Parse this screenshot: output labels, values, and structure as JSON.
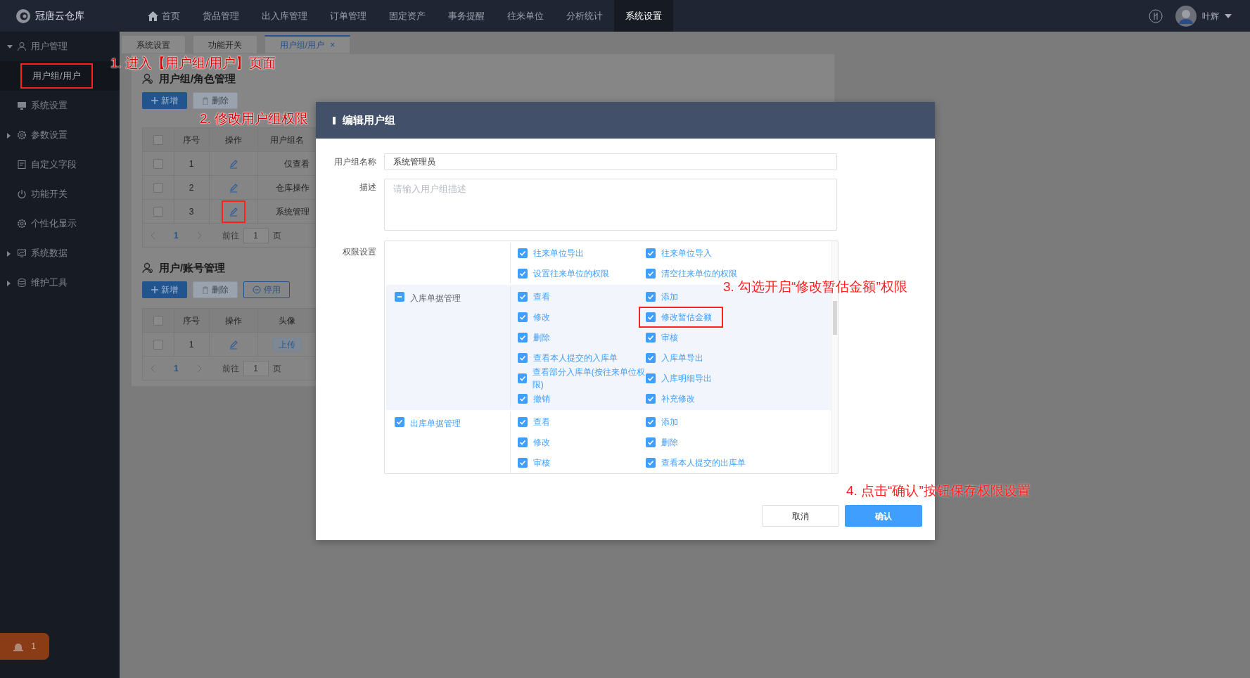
{
  "topbar": {
    "brand": "冠唐云仓库",
    "nav": [
      {
        "label": "首页",
        "selected": false
      },
      {
        "label": "货品管理",
        "selected": false
      },
      {
        "label": "出入库管理",
        "selected": false
      },
      {
        "label": "订单管理",
        "selected": false
      },
      {
        "label": "固定资产",
        "selected": false
      },
      {
        "label": "事务提醒",
        "selected": false
      },
      {
        "label": "往来单位",
        "selected": false
      },
      {
        "label": "分析统计",
        "selected": false
      },
      {
        "label": "系统设置",
        "selected": true
      }
    ],
    "user": {
      "name": "叶辉"
    }
  },
  "sidebar": {
    "items": [
      {
        "label": "用户管理",
        "kind": "group",
        "expanded": true,
        "selected": false,
        "children": [
          {
            "label": "用户组/用户",
            "selected": true,
            "highlighted": true
          }
        ]
      },
      {
        "label": "系统设置",
        "kind": "link",
        "selected": false
      },
      {
        "label": "参数设置",
        "kind": "group",
        "expanded": false,
        "selected": false
      },
      {
        "label": "自定义字段",
        "kind": "link",
        "selected": false
      },
      {
        "label": "功能开关",
        "kind": "link",
        "selected": false
      },
      {
        "label": "个性化显示",
        "kind": "link",
        "selected": false
      },
      {
        "label": "系统数据",
        "kind": "group",
        "expanded": false,
        "selected": false
      },
      {
        "label": "维护工具",
        "kind": "group",
        "expanded": false,
        "selected": false
      }
    ],
    "alert_badge": {
      "count": "1"
    }
  },
  "tabs": [
    {
      "label": "系统设置",
      "selected": false,
      "closable": false
    },
    {
      "label": "功能开关",
      "selected": false,
      "closable": false
    },
    {
      "label": "用户组/用户",
      "selected": true,
      "closable": true,
      "close": "×"
    }
  ],
  "sections": [
    {
      "title": "用户组/角色管理",
      "buttons": [
        {
          "label": "新增",
          "kind": "primary",
          "disabled": false
        },
        {
          "label": "删除",
          "kind": "delete",
          "disabled": true
        }
      ],
      "table": {
        "all_checked": false,
        "columns": [
          "序号",
          "操作",
          "用户组名"
        ],
        "rows": [
          {
            "checked": false,
            "index": "1",
            "name": "仅查看",
            "highlighted": false
          },
          {
            "checked": false,
            "index": "2",
            "name": "仓库操作",
            "highlighted": false
          },
          {
            "checked": false,
            "index": "3",
            "name": "系统管理",
            "highlighted": true
          }
        ]
      },
      "pager": {
        "page": "1",
        "goto_label": "前往",
        "goto_value": "1",
        "unit": "页"
      }
    },
    {
      "title": "用户/账号管理",
      "buttons": [
        {
          "label": "新增",
          "kind": "primary",
          "disabled": false
        },
        {
          "label": "删除",
          "kind": "delete",
          "disabled": true
        },
        {
          "label": "停用",
          "kind": "disable",
          "disabled": false
        }
      ],
      "table": {
        "all_checked": false,
        "columns": [
          "序号",
          "操作",
          "头像"
        ],
        "rows": [
          {
            "checked": false,
            "index": "1",
            "upload": "上传",
            "highlighted": false
          }
        ]
      },
      "pager": {
        "page": "1",
        "goto_label": "前往",
        "goto_value": "1",
        "unit": "页"
      }
    }
  ],
  "modal": {
    "title": "编辑用户组",
    "fields": [
      {
        "label": "用户组名称",
        "value": "系统管理员"
      },
      {
        "label": "描述",
        "placeholder": "请输入用户组描述"
      }
    ],
    "permissions_label": "权限设置",
    "permission_groups": [
      {
        "hovered": false,
        "permissions": [
          {
            "label": "往来单位导出",
            "checked": true,
            "highlighted": false
          },
          {
            "label": "往来单位导入",
            "checked": true,
            "highlighted": false
          },
          {
            "label": "设置往来单位的权限",
            "checked": true,
            "highlighted": false
          },
          {
            "label": "清空往来单位的权限",
            "checked": true,
            "highlighted": false
          }
        ]
      },
      {
        "name": "入库单据管理",
        "checked": false,
        "indeterminate": true,
        "hovered": true,
        "permissions": [
          {
            "label": "查看",
            "checked": true,
            "highlighted": false
          },
          {
            "label": "添加",
            "checked": true,
            "highlighted": false
          },
          {
            "label": "修改",
            "checked": true,
            "highlighted": false
          },
          {
            "label": "修改暂估金额",
            "checked": true,
            "highlighted": true
          },
          {
            "label": "删除",
            "checked": true,
            "highlighted": false
          },
          {
            "label": "审核",
            "checked": true,
            "highlighted": false
          },
          {
            "label": "查看本人提交的入库单",
            "checked": true,
            "highlighted": false
          },
          {
            "label": "入库单导出",
            "checked": true,
            "highlighted": false
          },
          {
            "label": "查看部分入库单(按往来单位权限)",
            "checked": true,
            "highlighted": false
          },
          {
            "label": "入库明细导出",
            "checked": true,
            "highlighted": false
          },
          {
            "label": "撤销",
            "checked": true,
            "highlighted": false
          },
          {
            "label": "补充修改",
            "checked": true,
            "highlighted": false
          }
        ]
      },
      {
        "name": "出库单据管理",
        "checked": true,
        "indeterminate": false,
        "hovered": false,
        "permissions": [
          {
            "label": "查看",
            "checked": true,
            "highlighted": false
          },
          {
            "label": "添加",
            "checked": true,
            "highlighted": false
          },
          {
            "label": "修改",
            "checked": true,
            "highlighted": false
          },
          {
            "label": "删除",
            "checked": true,
            "highlighted": false
          },
          {
            "label": "审核",
            "checked": true,
            "highlighted": false
          },
          {
            "label": "查看本人提交的出库单",
            "checked": true,
            "highlighted": false
          }
        ]
      }
    ],
    "buttons": [
      {
        "label": "取消",
        "kind": "secondary"
      },
      {
        "label": "确认",
        "kind": "primary"
      }
    ]
  },
  "annotations": [
    {
      "text": "1. 进入【用户组/用户】页面"
    },
    {
      "text": "2. 修改用户组权限"
    },
    {
      "text": "3. 勾选开启“修改暂估金额”权限"
    },
    {
      "text": "4. 点击“确认”按钮保存权限设置"
    }
  ]
}
